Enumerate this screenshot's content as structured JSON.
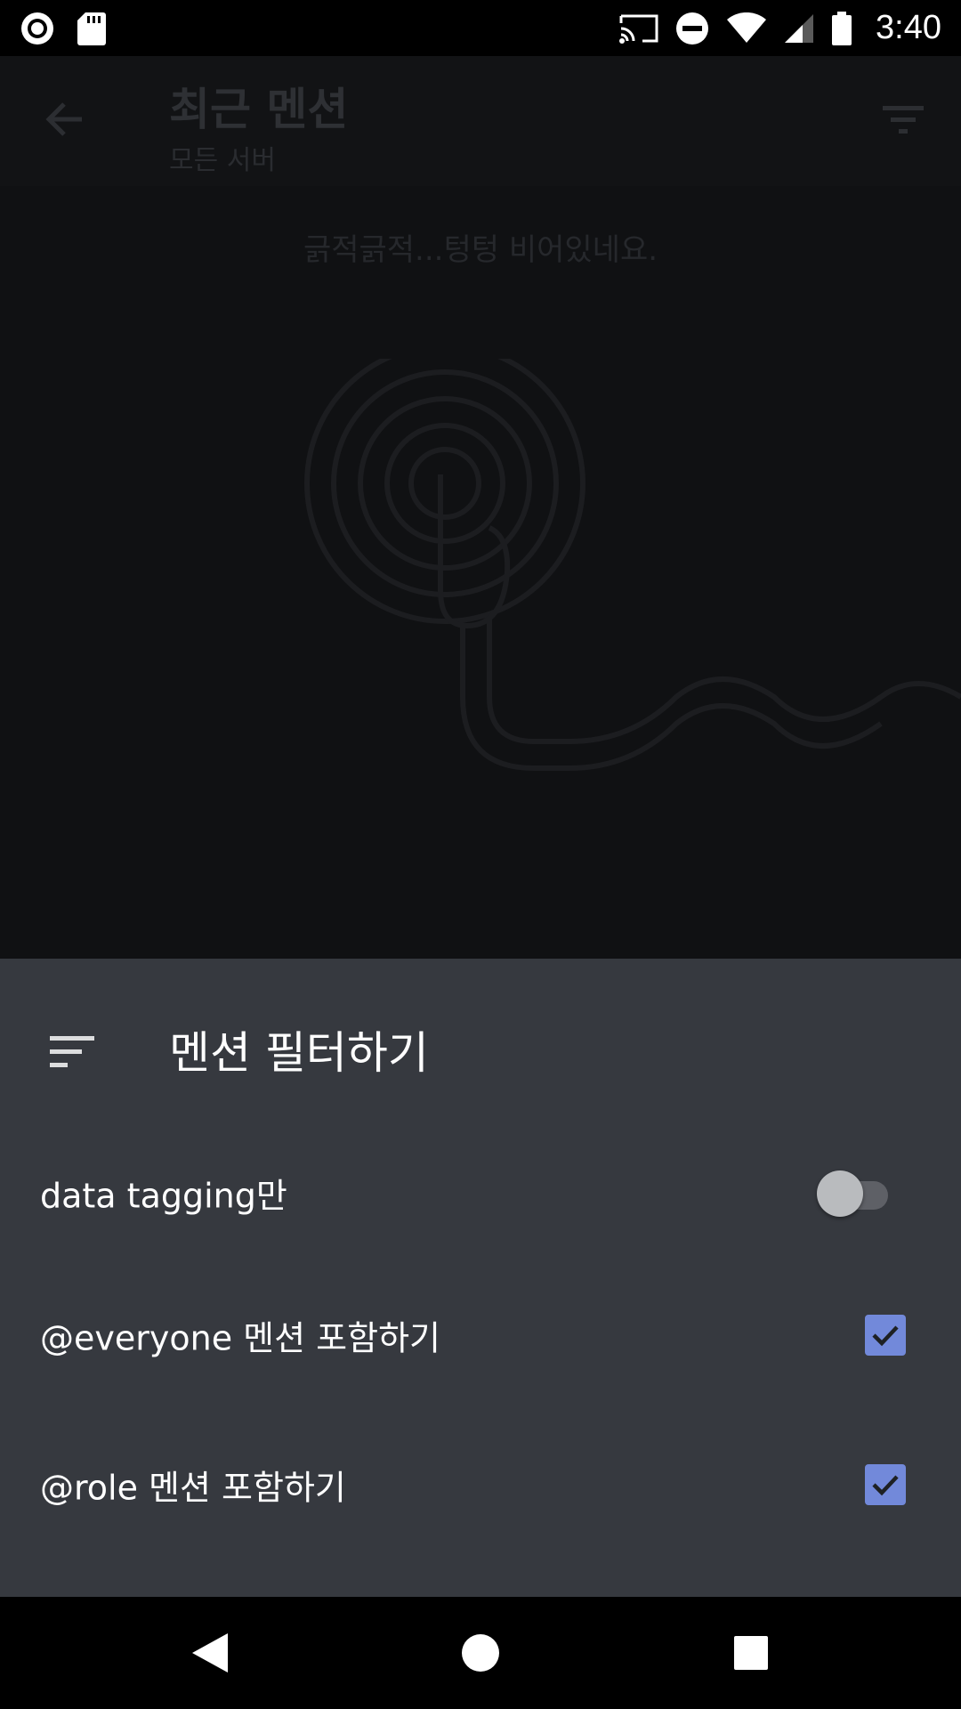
{
  "status_bar": {
    "time": "3:40",
    "icons": [
      "record-icon",
      "sd-card-icon",
      "cast-icon",
      "do-not-disturb-icon",
      "wifi-icon",
      "cell-signal-icon",
      "battery-icon"
    ]
  },
  "background_screen": {
    "title": "최근 멘션",
    "subtitle": "모든 서버",
    "empty_message": "긁적긁적...텅텅 비어있네요."
  },
  "sheet": {
    "title": "멘션 필터하기",
    "options": [
      {
        "label": "data tagging만",
        "control": "toggle",
        "checked": false
      },
      {
        "label": "@everyone 멘션 포함하기",
        "control": "checkbox",
        "checked": true
      },
      {
        "label": "@role 멘션 포함하기",
        "control": "checkbox",
        "checked": true
      }
    ]
  },
  "colors": {
    "sheet_bg": "#36393f",
    "accent": "#7289da",
    "nav_bg": "#000000"
  },
  "nav": [
    "back-icon",
    "home-icon",
    "recents-icon"
  ]
}
